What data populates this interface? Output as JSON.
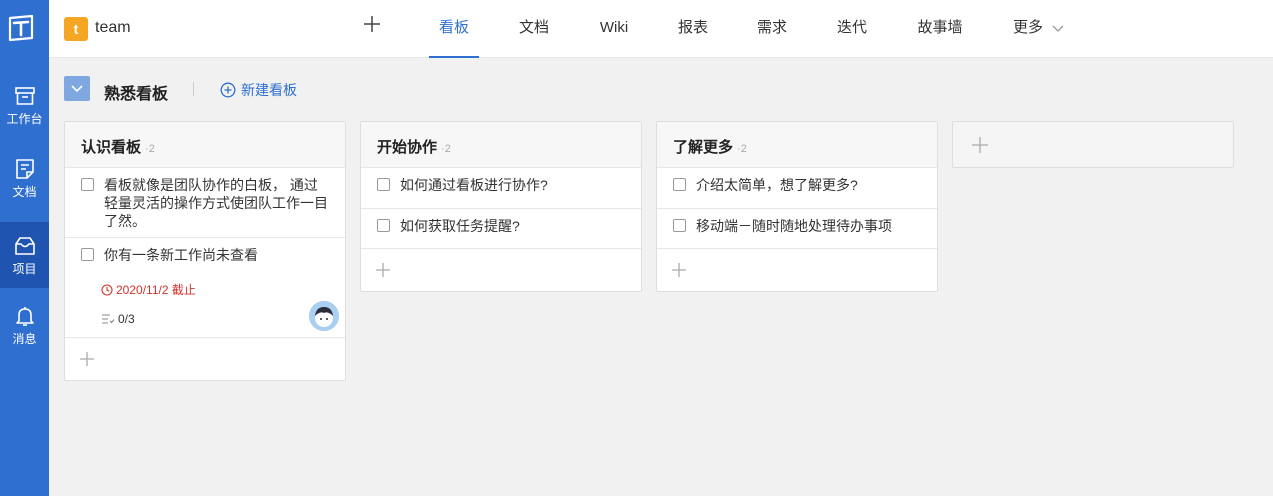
{
  "sidebar": {
    "items": [
      {
        "label": "工作台",
        "icon": "inbox-tray-icon"
      },
      {
        "label": "文档",
        "icon": "document-icon"
      },
      {
        "label": "项目",
        "icon": "project-icon",
        "active": true
      },
      {
        "label": "消息",
        "icon": "bell-icon"
      }
    ]
  },
  "header": {
    "project_badge": "t",
    "project_name": "team",
    "tabs": [
      {
        "label": "看板",
        "active": true
      },
      {
        "label": "文档"
      },
      {
        "label": "Wiki"
      },
      {
        "label": "报表"
      },
      {
        "label": "需求"
      },
      {
        "label": "迭代"
      },
      {
        "label": "故事墙"
      },
      {
        "label": "更多"
      }
    ]
  },
  "board": {
    "title": "熟悉看板",
    "new_board_label": "新建看板"
  },
  "columns": [
    {
      "title": "认识看板",
      "count": "2",
      "cards": [
        {
          "text": "看板就像是团队协作的白板， 通过轻量灵活的操作方式使团队工作一目了然。"
        },
        {
          "text": "你有一条新工作尚未查看",
          "due": "2020/11/2 截止",
          "subtasks": "0/3"
        }
      ]
    },
    {
      "title": "开始协作",
      "count": "2",
      "cards": [
        {
          "text": "如何通过看板进行协作?"
        },
        {
          "text": "如何获取任务提醒?"
        }
      ]
    },
    {
      "title": "了解更多",
      "count": "2",
      "cards": [
        {
          "text": "介绍太简单，想了解更多?"
        },
        {
          "text": "移动端－随时随地处理待办事项"
        }
      ]
    }
  ],
  "colors": {
    "sidebar": "#2f6fd0",
    "accent": "#2f6fd0",
    "due": "#d0342c",
    "badge": "#f5a623"
  }
}
